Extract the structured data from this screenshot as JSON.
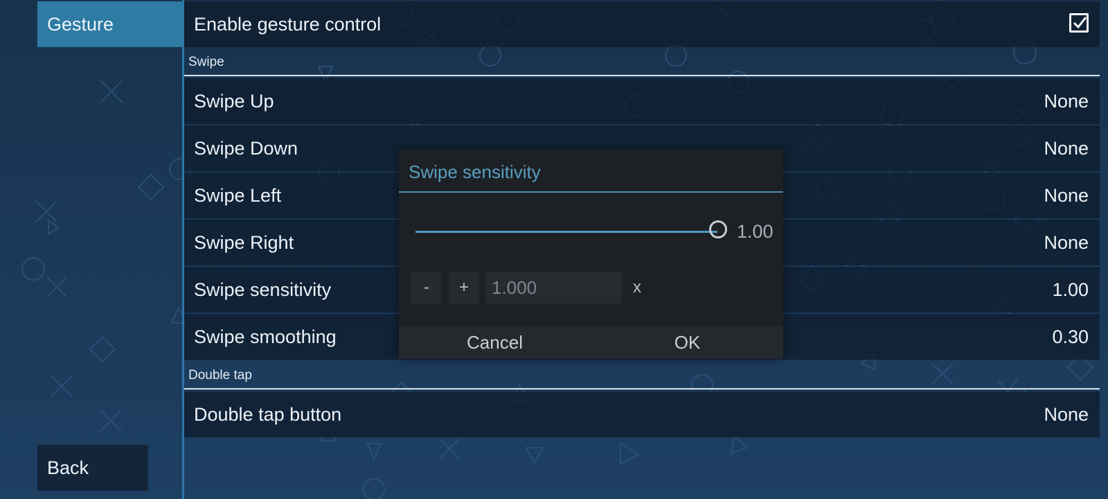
{
  "sidebar": {
    "active_tab": "Gesture",
    "back_label": "Back"
  },
  "settings": {
    "enable": {
      "label": "Enable gesture control",
      "checked": true
    },
    "swipe_header": "Swipe",
    "swipe_rows": [
      {
        "label": "Swipe Up",
        "value": "None"
      },
      {
        "label": "Swipe Down",
        "value": "None"
      },
      {
        "label": "Swipe Left",
        "value": "None"
      },
      {
        "label": "Swipe Right",
        "value": "None"
      },
      {
        "label": "Swipe sensitivity",
        "value": "1.00"
      },
      {
        "label": "Swipe smoothing",
        "value": "0.30"
      }
    ],
    "double_tap_header": "Double tap",
    "double_tap_row": {
      "label": "Double tap button",
      "value": "None"
    }
  },
  "dialog": {
    "title": "Swipe sensitivity",
    "slider_value": "1.00",
    "minus_label": "-",
    "plus_label": "+",
    "input_value": "1.000",
    "unit": "x",
    "cancel_label": "Cancel",
    "ok_label": "OK"
  },
  "colors": {
    "accent": "#2e7ba3",
    "dialog_title": "#5a9ec0",
    "background": "#1b3a5a"
  }
}
